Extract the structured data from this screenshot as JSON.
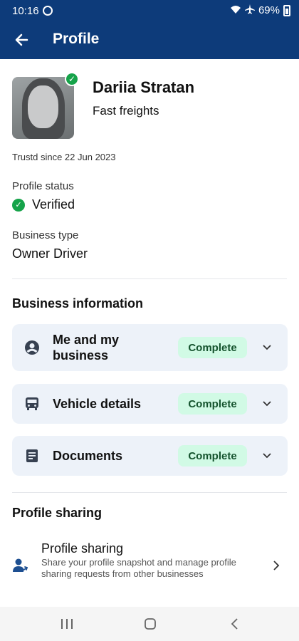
{
  "status_bar": {
    "time": "10:16",
    "battery": "69%",
    "left_icon": "sync-icon",
    "right_icons": [
      "wifi-icon",
      "airplane-icon",
      "battery-icon"
    ]
  },
  "app_bar": {
    "title": "Profile",
    "back_icon": "arrow-back-icon"
  },
  "profile": {
    "name": "Dariia Stratan",
    "company": "Fast freights",
    "trusted_since": "Trustd since 22 Jun 2023",
    "status_label": "Profile status",
    "status_value": "Verified",
    "business_type_label": "Business type",
    "business_type_value": "Owner Driver"
  },
  "business_information": {
    "title": "Business information",
    "items": [
      {
        "label": "Me and my business",
        "status": "Complete",
        "icon": "account-circle-icon"
      },
      {
        "label": "Vehicle details",
        "status": "Complete",
        "icon": "bus-icon"
      },
      {
        "label": "Documents",
        "status": "Complete",
        "icon": "document-icon"
      }
    ]
  },
  "profile_sharing": {
    "section_title": "Profile sharing",
    "item_title": "Profile sharing",
    "item_description": "Share your profile snapshot and manage profile sharing requests from other businesses",
    "icon": "person-share-icon"
  },
  "nav_bar": {
    "buttons": [
      "recents-icon",
      "home-icon",
      "back-icon"
    ]
  },
  "colors": {
    "primary": "#0d3b7a",
    "card_bg": "#edf2f9",
    "badge_bg": "#d1fae5",
    "badge_text": "#14532d",
    "verified_green": "#16a34a"
  }
}
